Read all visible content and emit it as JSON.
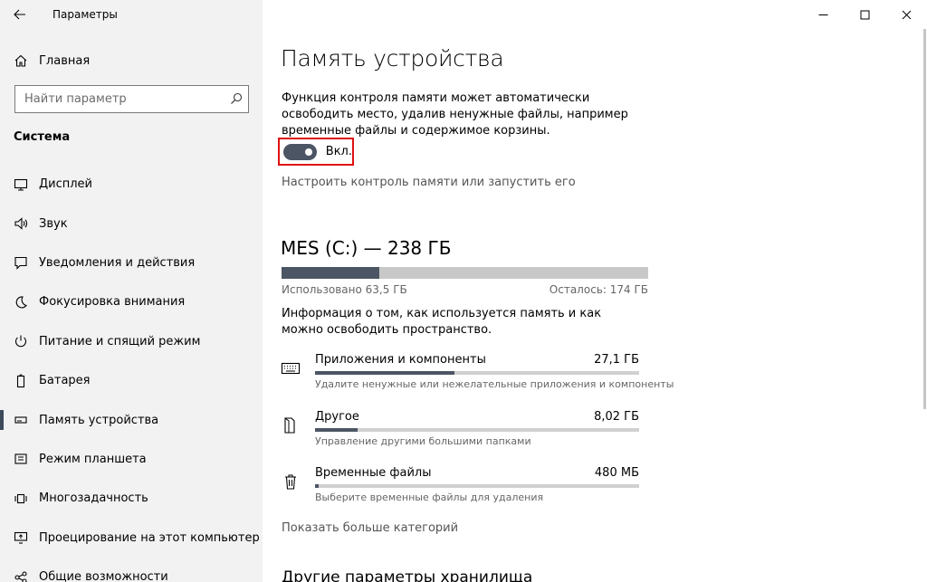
{
  "app": {
    "title": "Параметры"
  },
  "nav": {
    "home_label": "Главная",
    "search_placeholder": "Найти параметр",
    "section_title": "Система",
    "items": [
      {
        "label": "Дисплей",
        "icon": "display-icon"
      },
      {
        "label": "Звук",
        "icon": "speaker-icon"
      },
      {
        "label": "Уведомления и действия",
        "icon": "notification-icon"
      },
      {
        "label": "Фокусировка внимания",
        "icon": "moon-icon"
      },
      {
        "label": "Питание и спящий режим",
        "icon": "power-icon"
      },
      {
        "label": "Батарея",
        "icon": "battery-icon"
      },
      {
        "label": "Память устройства",
        "icon": "storage-icon",
        "selected": true
      },
      {
        "label": "Режим планшета",
        "icon": "tablet-icon"
      },
      {
        "label": "Многозадачность",
        "icon": "multitask-icon"
      },
      {
        "label": "Проецирование на этот компьютер",
        "icon": "project-icon"
      },
      {
        "label": "Общие возможности",
        "icon": "shared-icon"
      }
    ]
  },
  "main": {
    "title": "Память устройства",
    "description": "Функция контроля памяти может автоматически освободить место, удалив ненужные файлы, например временные файлы и содержимое корзины.",
    "toggle": {
      "label": "Вкл.",
      "on": true
    },
    "configure_link": "Настроить контроль памяти или запустить его",
    "drive": {
      "title": "MES (C:) — 238 ГБ",
      "used_label": "Использовано 63,5 ГБ",
      "free_label": "Осталось: 174 ГБ",
      "used_gb": 63.5,
      "total_gb": 238
    },
    "info": "Информация о том, как используется память и как можно освободить пространство.",
    "categories": [
      {
        "name": "Приложения и компоненты",
        "size": "27,1 ГБ",
        "sub": "Удалите ненужные или нежелательные приложения и компоненты",
        "icon": "keyboard-icon",
        "fraction": 0.43
      },
      {
        "name": "Другое",
        "size": "8,02 ГБ",
        "sub": "Управление другими большими папками",
        "icon": "folder-icon",
        "fraction": 0.13
      },
      {
        "name": "Временные файлы",
        "size": "480 МБ",
        "sub": "Выберите временные файлы для удаления",
        "icon": "trash-icon",
        "fraction": 0.01
      }
    ],
    "more_link": "Показать больше категорий",
    "other_title": "Другие параметры хранилища"
  },
  "colors": {
    "accent": "#4b5563",
    "highlight_border": "#e01010",
    "nav_bg": "#f2f2f2"
  }
}
